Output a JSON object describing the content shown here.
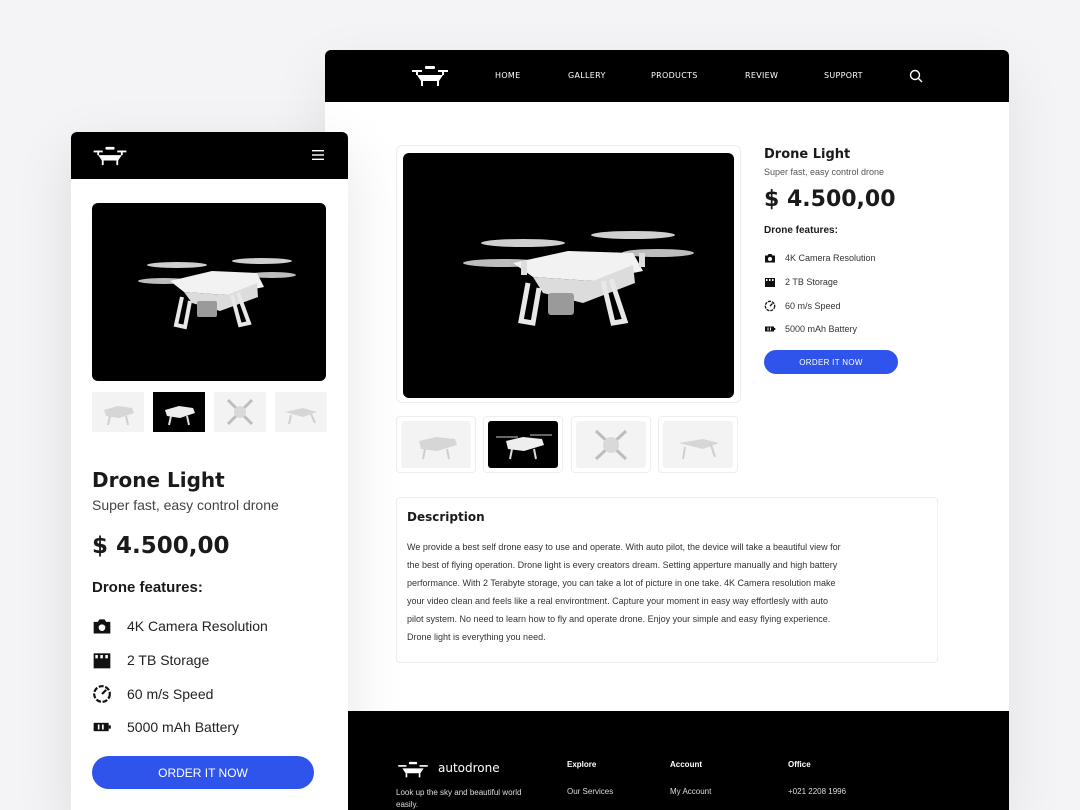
{
  "brand": {
    "name": "autodrone",
    "tagline": "Look up the sky and beautiful world easily."
  },
  "nav": {
    "items": [
      "HOME",
      "GALLERY",
      "PRODUCTS",
      "REVIEW",
      "SUPPORT"
    ]
  },
  "product": {
    "title": "Drone Light",
    "subtitle": "Super fast, easy control drone",
    "price": "$ 4.500,00",
    "features_heading": "Drone features:",
    "features": [
      {
        "icon": "camera-icon",
        "label": "4K Camera Resolution"
      },
      {
        "icon": "storage-icon",
        "label": "2 TB Storage"
      },
      {
        "icon": "speedometer-icon",
        "label": "60 m/s Speed"
      },
      {
        "icon": "battery-icon",
        "label": "5000 mAh Battery"
      }
    ],
    "order_label_desktop": "ORDER IT NOW",
    "order_label_mobile": "ORDER IT NOW"
  },
  "description": {
    "heading": "Description",
    "lines": [
      "We provide a best self drone easy to use and operate. With auto pilot, the device will take a beautiful view for",
      "the best of flying operation. Drone light is every creators dream. Setting apperture manually and high battery",
      "performance. With 2 Terabyte storage, you can take a lot of picture in one take. 4K Camera resolution make",
      "your video clean and feels like a real environtment. Capture your moment in easy way effortlesly with auto",
      "pilot system. No need to learn how to fly and operate drone. Enjoy your simple and easy flying experience.",
      "Drone light is everything you need."
    ]
  },
  "footer": {
    "columns": [
      {
        "heading": "Explore",
        "first_link": "Our Services"
      },
      {
        "heading": "Account",
        "first_link": "My Account"
      },
      {
        "heading": "Office",
        "first_link": "+021 2208 1996"
      }
    ]
  },
  "colors": {
    "accent": "#2f54eb",
    "dark": "#000000"
  }
}
